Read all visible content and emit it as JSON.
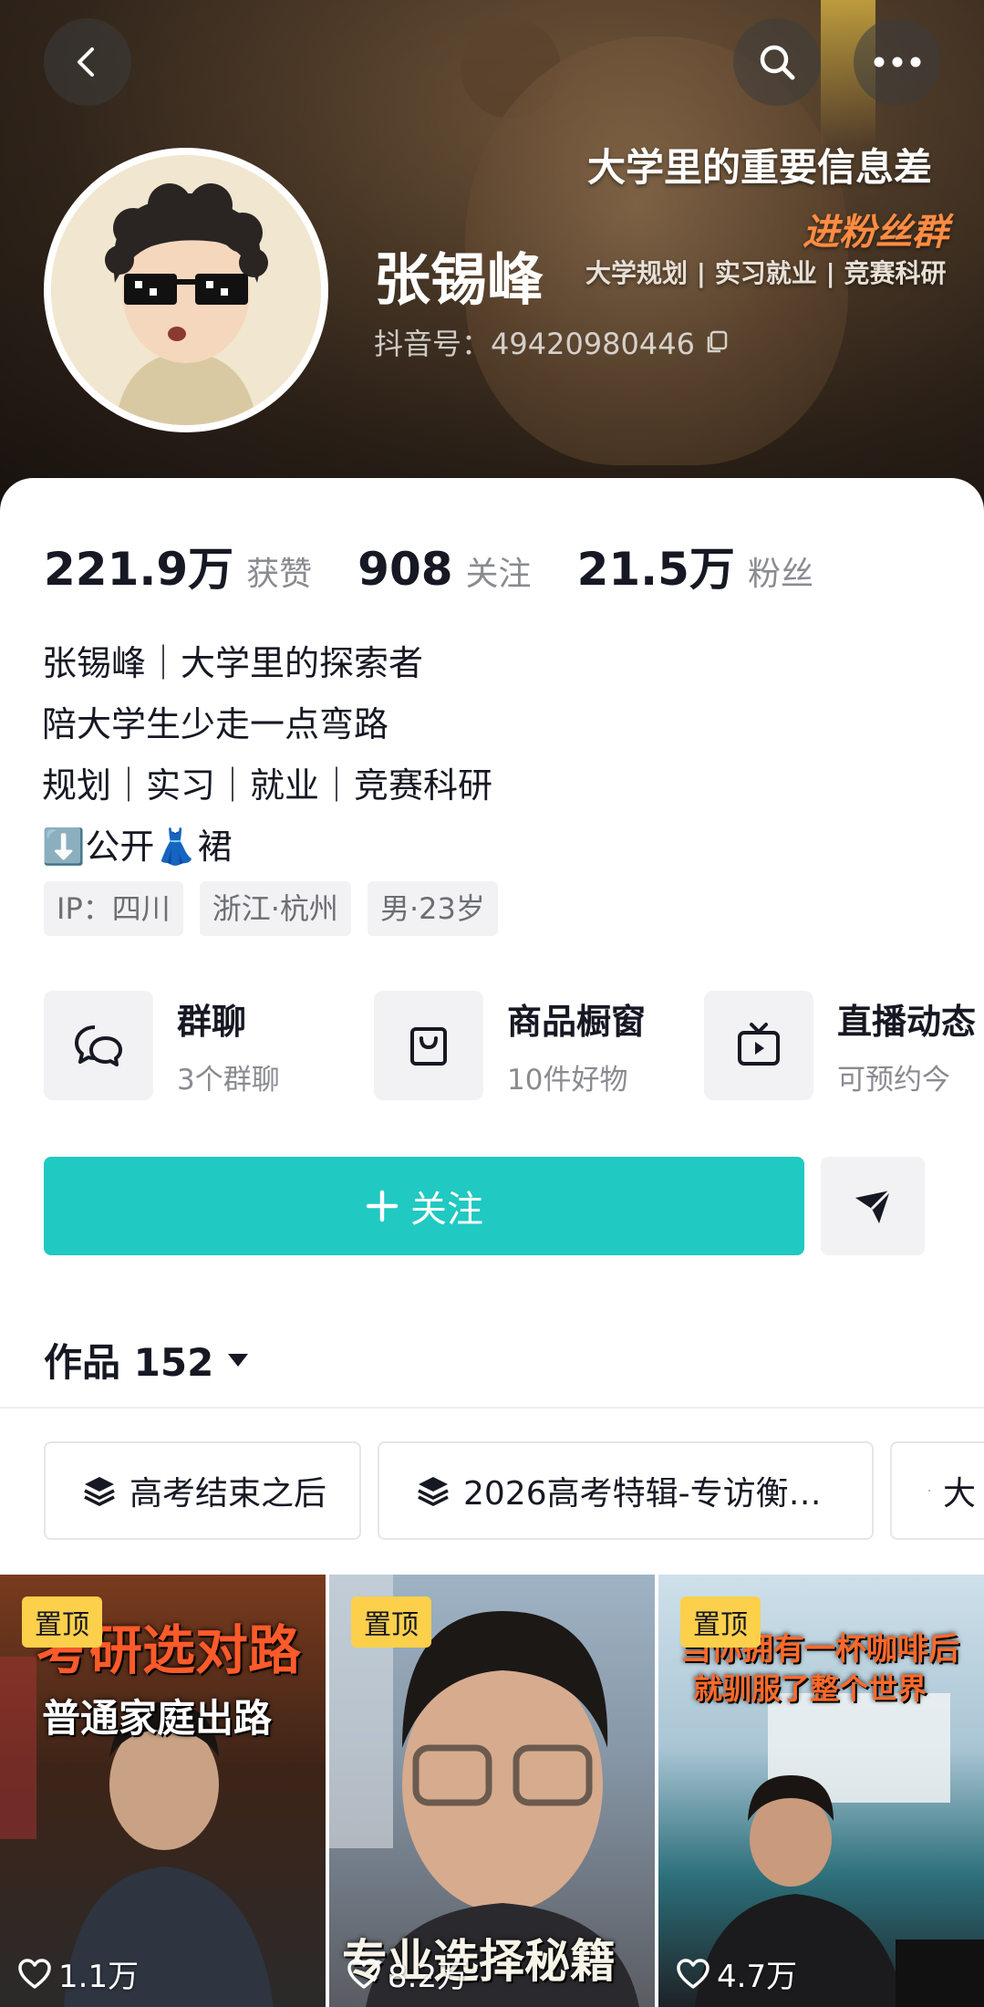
{
  "banner": {
    "title": "大学里的重要信息差",
    "subtitle": "进粉丝群",
    "tags": "大学规划 | 实习就业 | 竞赛科研"
  },
  "profile": {
    "name": "张锡峰",
    "douyin_id": "抖音号：49420980446"
  },
  "stats": [
    {
      "value": "221.9万",
      "label": "获赞"
    },
    {
      "value": "908",
      "label": "关注"
    },
    {
      "value": "21.5万",
      "label": "粉丝"
    }
  ],
  "bio": [
    "张锡峰｜大学里的探索者",
    "陪大学生少走一点弯路",
    "规划｜实习｜就业｜竞赛科研",
    "⬇️公开👗裙"
  ],
  "tags": [
    "IP：四川",
    "浙江·杭州",
    "男·23岁"
  ],
  "features": [
    {
      "title": "群聊",
      "sub": "3个群聊",
      "icon": "chat-bubbles-icon"
    },
    {
      "title": "商品橱窗",
      "sub": "10件好物",
      "icon": "shopping-bag-icon"
    },
    {
      "title": "直播动态",
      "sub": "可预约今",
      "icon": "tv-play-icon"
    }
  ],
  "actions": {
    "follow_label": "关注",
    "follow_color": "#20c9c1"
  },
  "works": {
    "label": "作品 152"
  },
  "collections": [
    "高考结束之后",
    "2026高考特辑-专访衡…",
    "大"
  ],
  "videos": [
    {
      "pin": "置顶",
      "likes": "1.1万",
      "overlay_top": "考研选对路",
      "overlay_mid": "普通家庭出路"
    },
    {
      "pin": "置顶",
      "likes": "8.2万",
      "overlay_bottom": "专业选择秘籍"
    },
    {
      "pin": "置顶",
      "likes": "4.7万",
      "overlay_top": "当你拥有一杯咖啡后",
      "overlay_mid": "就驯服了整个世界"
    }
  ]
}
